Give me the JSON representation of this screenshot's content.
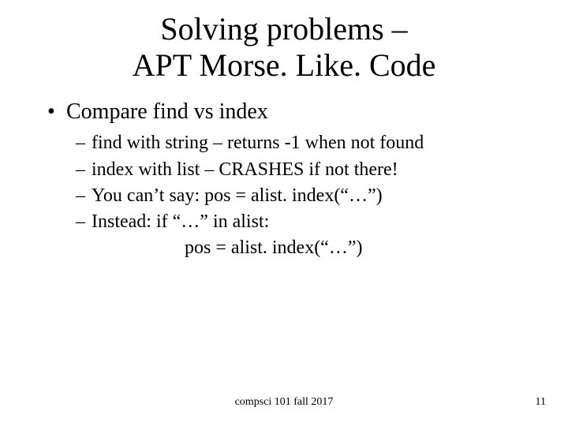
{
  "title_line1": "Solving problems –",
  "title_line2": "APT Morse. Like. Code",
  "main_bullet": "Compare find vs index",
  "subs": [
    "find with string – returns -1 when not found",
    "index with list – CRASHES if not there!",
    "You can’t say: pos = alist. index(“…”)",
    "Instead: if “…” in alist:"
  ],
  "continuation": "pos = alist. index(“…”)",
  "footer_center": "compsci 101 fall 2017",
  "footer_right": "11"
}
